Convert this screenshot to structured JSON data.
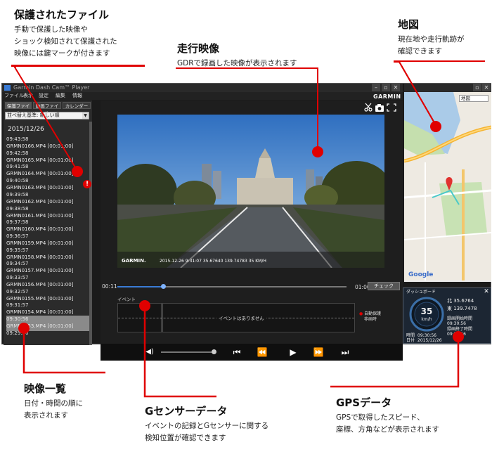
{
  "app": {
    "title": "Garmin Dash Cam™ Player",
    "brand": "GARMIN",
    "menu": [
      "ファイル",
      "表示",
      "設定",
      "編集",
      "情報"
    ],
    "tabs": [
      "保護ファイル",
      "動画ファイル",
      "カレンダー"
    ],
    "sort_label": "並べ替え基準: 新しい順",
    "date_header": "2015/12/26",
    "videos": [
      {
        "time": "09:43:58",
        "file": "GRMN0166.MP4 [00:01:00]"
      },
      {
        "time": "09:42:58",
        "file": "GRMN0165.MP4 [00:01:00]"
      },
      {
        "time": "09:41:58",
        "file": "GRMN0164.MP4 [00:01:00]"
      },
      {
        "time": "09:40:58",
        "file": "GRMN0163.MP4 [00:01:00]"
      },
      {
        "time": "09:39:58",
        "file": "GRMN0162.MP4 [00:01:00]"
      },
      {
        "time": "09:38:58",
        "file": "GRMN0161.MP4 [00:01:00]"
      },
      {
        "time": "09:37:58",
        "file": "GRMN0160.MP4 [00:01:00]"
      },
      {
        "time": "09:36:57",
        "file": "GRMN0159.MP4 [00:01:00]"
      },
      {
        "time": "09:35:57",
        "file": "GRMN0158.MP4 [00:01:00]"
      },
      {
        "time": "09:34:57",
        "file": "GRMN0157.MP4 [00:01:00]"
      },
      {
        "time": "09:33:57",
        "file": "GRMN0156.MP4 [00:01:00]"
      },
      {
        "time": "09:32:57",
        "file": "GRMN0155.MP4 [00:01:00]"
      },
      {
        "time": "09:31:57",
        "file": "GRMN0154.MP4 [00:01:00]"
      },
      {
        "time": "09:30:56",
        "file": "GRMN0153.MP4 [00:01:00]"
      },
      {
        "time": "09:29:56",
        "file": ""
      }
    ],
    "video_overlay": {
      "brand": "GARMIN.",
      "stamp": "2015-12-26  9:31:07   35.67640 139.74783   35 KM/H"
    },
    "time_current": "00:11",
    "time_total": "01:00",
    "progress_fraction": 0.2,
    "check_button": "チェック",
    "event_label": "イベント",
    "no_events": "イベントはありません",
    "legend": [
      "自動保護",
      "非画時"
    ],
    "map_select": "地図",
    "dashboard": {
      "title": "ダッシュボード",
      "speed": "35",
      "speed_unit": "km/h",
      "lat": "北 35.6764",
      "lon": "東 139.7478",
      "rec_start_label": "録画開始時間",
      "rec_start": "09:30:56",
      "rec_end_label": "録画終了時間",
      "rec_end": "09:31:56",
      "time_label": "時間",
      "time_value": "09:30:56",
      "date_label": "日付",
      "date_value": "2015/12/26"
    }
  },
  "callouts": {
    "protected": {
      "title": "保護されたファイル",
      "desc": "手動で保護した映像や\nショック検知されて保護された\n映像には鍵マークが付きます"
    },
    "video": {
      "title": "走行映像",
      "desc": "GDRで録画した映像が表示されます"
    },
    "map": {
      "title": "地図",
      "desc": "現在地や走行軌跡が\n確認できます"
    },
    "list": {
      "title": "映像一覧",
      "desc": "日付・時間の順に\n表示されます"
    },
    "gsensor": {
      "title": "Gセンサーデータ",
      "desc": "イベントの記録とGセンサーに関する\n検知位置が確認できます"
    },
    "gps": {
      "title": "GPSデータ",
      "desc": "GPSで取得したスピード、\n座標、方角などが表示されます"
    }
  },
  "colors": {
    "accent": "#e00000",
    "progress": "#3a7bd5"
  }
}
